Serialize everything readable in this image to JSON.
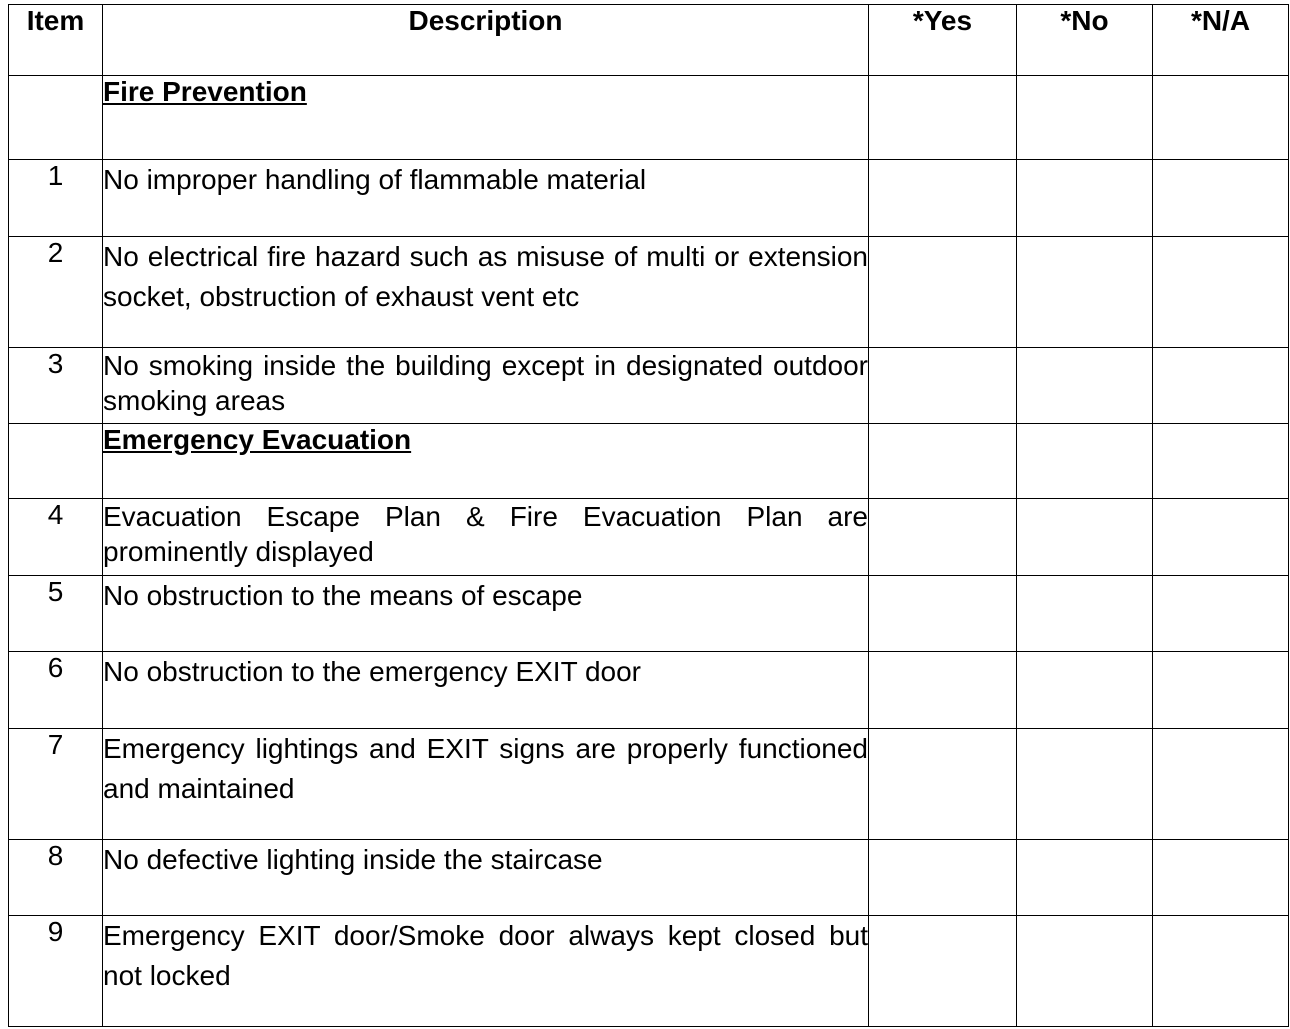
{
  "headers": {
    "item": "Item",
    "description": "Description",
    "yes": "*Yes",
    "no": "*No",
    "na": "*N/A"
  },
  "rows": [
    {
      "type": "section",
      "item": "",
      "description": "Fire Prevention"
    },
    {
      "type": "item",
      "item": "1",
      "description": "No improper handling of flammable material"
    },
    {
      "type": "item",
      "item": "2",
      "description": "No electrical fire hazard such as misuse of multi or extension socket, obstruction of exhaust vent etc"
    },
    {
      "type": "item",
      "item": "3",
      "description": "No smoking inside the building except in designated outdoor smoking areas"
    },
    {
      "type": "section",
      "item": "",
      "description": "Emergency Evacuation"
    },
    {
      "type": "item",
      "item": "4",
      "description": "Evacuation Escape Plan & Fire Evacuation Plan are prominently displayed"
    },
    {
      "type": "item",
      "item": "5",
      "description": "No obstruction to the means of escape"
    },
    {
      "type": "item",
      "item": "6",
      "description": "No obstruction to the emergency EXIT door"
    },
    {
      "type": "item",
      "item": "7",
      "description": "Emergency lightings and EXIT signs are properly functioned and maintained"
    },
    {
      "type": "item",
      "item": "8",
      "description": "No defective lighting inside the staircase"
    },
    {
      "type": "item",
      "item": "9",
      "description": "Emergency EXIT door/Smoke door always kept closed but not locked"
    }
  ]
}
